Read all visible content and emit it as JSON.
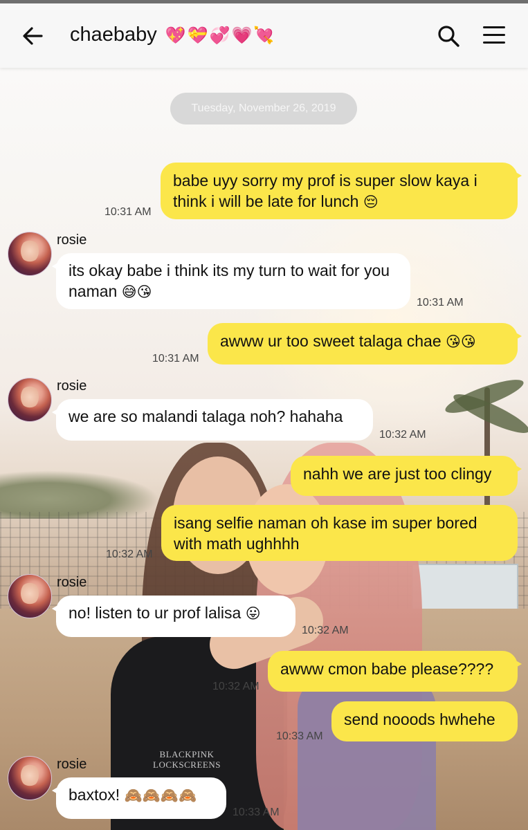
{
  "header": {
    "title": "chaebaby",
    "title_emoji": "💖💝💞💗💘"
  },
  "chat": {
    "date": "Tuesday, November 26, 2019",
    "sender_name": "rosie",
    "messages": [
      {
        "dir": "out",
        "text": "babe uyy sorry my prof is super slow kaya i think i will be late for lunch",
        "emoji": "😔",
        "time": "10:31 AM"
      },
      {
        "dir": "in",
        "text": "its okay babe i think its my turn to wait for you naman",
        "emoji": "😅😘",
        "time": "10:31 AM"
      },
      {
        "dir": "out",
        "text": "awww ur too sweet talaga chae",
        "emoji": "😘😘",
        "time": "10:31 AM"
      },
      {
        "dir": "in",
        "text": "we are so malandi talaga noh? hahaha",
        "emoji": "",
        "time": "10:32 AM"
      },
      {
        "dir": "out",
        "text": "nahh we are just too clingy",
        "emoji": "",
        "time": ""
      },
      {
        "dir": "out",
        "text": "isang selfie naman oh kase im super bored with math ughhhh",
        "emoji": "",
        "time": "10:32 AM"
      },
      {
        "dir": "in",
        "text": "no! listen to ur prof lalisa",
        "emoji": "😛",
        "time": "10:32 AM"
      },
      {
        "dir": "out",
        "text": "awww cmon babe please????",
        "emoji": "",
        "time": "10:32 AM"
      },
      {
        "dir": "out",
        "text": "send nooods hwhehe",
        "emoji": "",
        "time": "10:33 AM"
      },
      {
        "dir": "in",
        "text": "baxtox!",
        "emoji": "🙈🙈🙈🙈",
        "time": "10:33 AM"
      }
    ]
  },
  "background": {
    "watermark_line1": "BLACKPINK",
    "watermark_line2": "LOCKSCREENS"
  },
  "colors": {
    "outgoing_bubble": "#fbe64a",
    "incoming_bubble": "#ffffff",
    "header_bg": "#f7f7f7"
  },
  "icons": [
    "back-arrow-icon",
    "search-icon",
    "menu-icon"
  ]
}
